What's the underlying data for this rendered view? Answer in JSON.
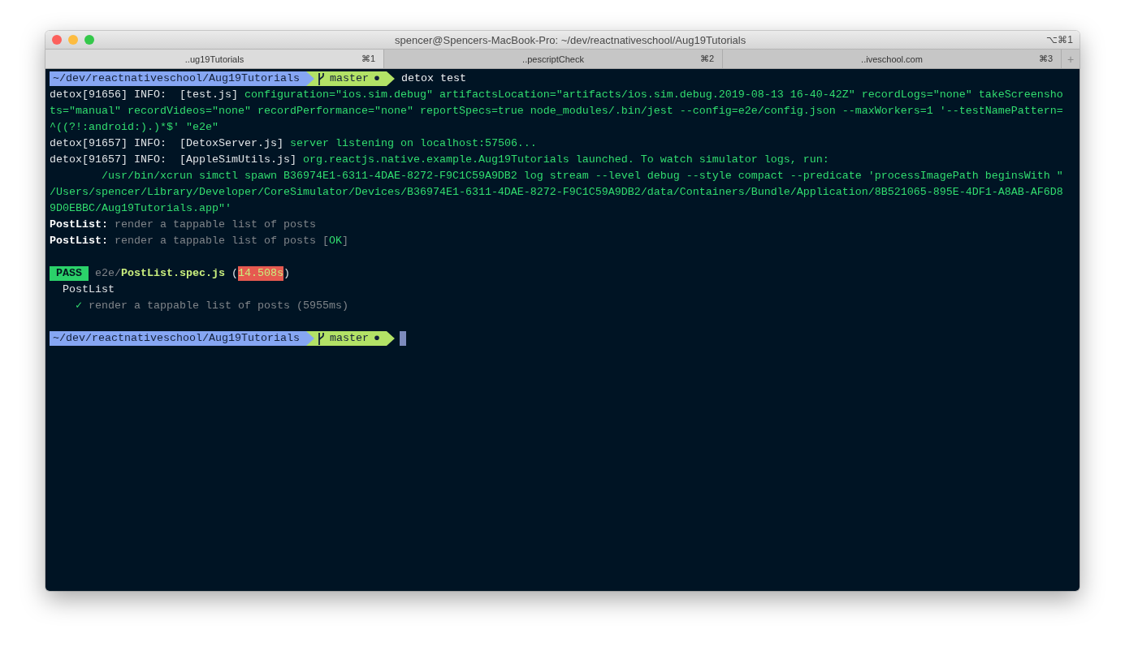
{
  "window": {
    "title": "spencer@Spencers-MacBook-Pro: ~/dev/reactnativeschool/Aug19Tutorials",
    "shortcut": "⌥⌘1"
  },
  "tabs": [
    {
      "label": "..ug19Tutorials",
      "shortcut": "⌘1",
      "selected": true
    },
    {
      "label": "..pescriptCheck",
      "shortcut": "⌘2",
      "selected": false
    },
    {
      "label": "..iveschool.com",
      "shortcut": "⌘3",
      "selected": false
    }
  ],
  "new_tab": "+",
  "lines": [
    {
      "kind": "prompt",
      "path": "~/dev/reactnativeschool/Aug19Tutorials",
      "branch": "master",
      "status": "●",
      "command": "detox test",
      "cursor": false
    },
    {
      "kind": "text",
      "segments": [
        {
          "text": "detox[91656] INFO:  [test.js] ",
          "kind": "prefix"
        },
        {
          "text": "configuration=\"ios.sim.debug\" artifactsLocation=\"artifacts/ios.sim.debug.2019-08-13 16-40-42Z\" recordLogs=\"none\" takeScreensho",
          "kind": "message"
        }
      ]
    },
    {
      "kind": "text",
      "segments": [
        {
          "text": "ts=\"manual\" recordVideos=\"none\" recordPerformance=\"none\" reportSpecs=true node_modules/.bin/jest --config=e2e/config.json --maxWorkers=1 '--testNamePattern=",
          "kind": "message"
        }
      ]
    },
    {
      "kind": "text",
      "segments": [
        {
          "text": "^((?!:android:).)*$' \"e2e\"",
          "kind": "message"
        }
      ]
    },
    {
      "kind": "text",
      "segments": [
        {
          "text": "detox[91657] INFO:  [DetoxServer.js] ",
          "kind": "prefix"
        },
        {
          "text": "server listening on localhost:57506...",
          "kind": "message"
        }
      ]
    },
    {
      "kind": "text",
      "segments": [
        {
          "text": "detox[91657] INFO:  [AppleSimUtils.js] ",
          "kind": "prefix"
        },
        {
          "text": "org.reactjs.native.example.Aug19Tutorials launched. To watch simulator logs, run:",
          "kind": "message"
        }
      ]
    },
    {
      "kind": "text",
      "segments": [
        {
          "text": "        /usr/bin/xcrun simctl spawn B36974E1-6311-4DAE-8272-F9C1C59A9DB2 log stream --level debug --style compact --predicate 'processImagePath beginsWith \"",
          "kind": "message"
        }
      ]
    },
    {
      "kind": "text",
      "segments": [
        {
          "text": "/Users/spencer/Library/Developer/CoreSimulator/Devices/B36974E1-6311-4DAE-8272-F9C1C59A9DB2/data/Containers/Bundle/Application/8B521065-895E-4DF1-A8AB-AF6D8",
          "kind": "message"
        }
      ]
    },
    {
      "kind": "text",
      "segments": [
        {
          "text": "9D0EBBC/Aug19Tutorials.app\"'",
          "kind": "message"
        }
      ]
    },
    {
      "kind": "text",
      "segments": [
        {
          "text": "PostList:",
          "kind": "suite"
        },
        {
          "text": " render a tappable list of posts",
          "kind": "description"
        }
      ]
    },
    {
      "kind": "text",
      "segments": [
        {
          "text": "PostList:",
          "kind": "suite"
        },
        {
          "text": " render a tappable list of posts [",
          "kind": "description"
        },
        {
          "text": "OK",
          "kind": "message"
        },
        {
          "text": "]",
          "kind": "description"
        }
      ]
    },
    {
      "kind": "blank"
    },
    {
      "kind": "text",
      "segments": [
        {
          "text": " PASS ",
          "kind": "result"
        },
        {
          "text": " e2e/",
          "kind": "description"
        },
        {
          "text": "PostList.spec.js",
          "kind": "file"
        },
        {
          "text": " (",
          "kind": "prefix"
        },
        {
          "text": "14.508s",
          "kind": "duration"
        },
        {
          "text": ")",
          "kind": "prefix"
        }
      ]
    },
    {
      "kind": "text",
      "segments": [
        {
          "text": "  PostList",
          "kind": "prefix"
        }
      ]
    },
    {
      "kind": "text",
      "segments": [
        {
          "text": "    ✓",
          "kind": "message"
        },
        {
          "text": " render a tappable list of posts (5955ms)",
          "kind": "description"
        }
      ]
    },
    {
      "kind": "blank"
    },
    {
      "kind": "prompt",
      "path": "~/dev/reactnativeschool/Aug19Tutorials",
      "branch": "master",
      "status": "●",
      "cursor": true
    }
  ]
}
